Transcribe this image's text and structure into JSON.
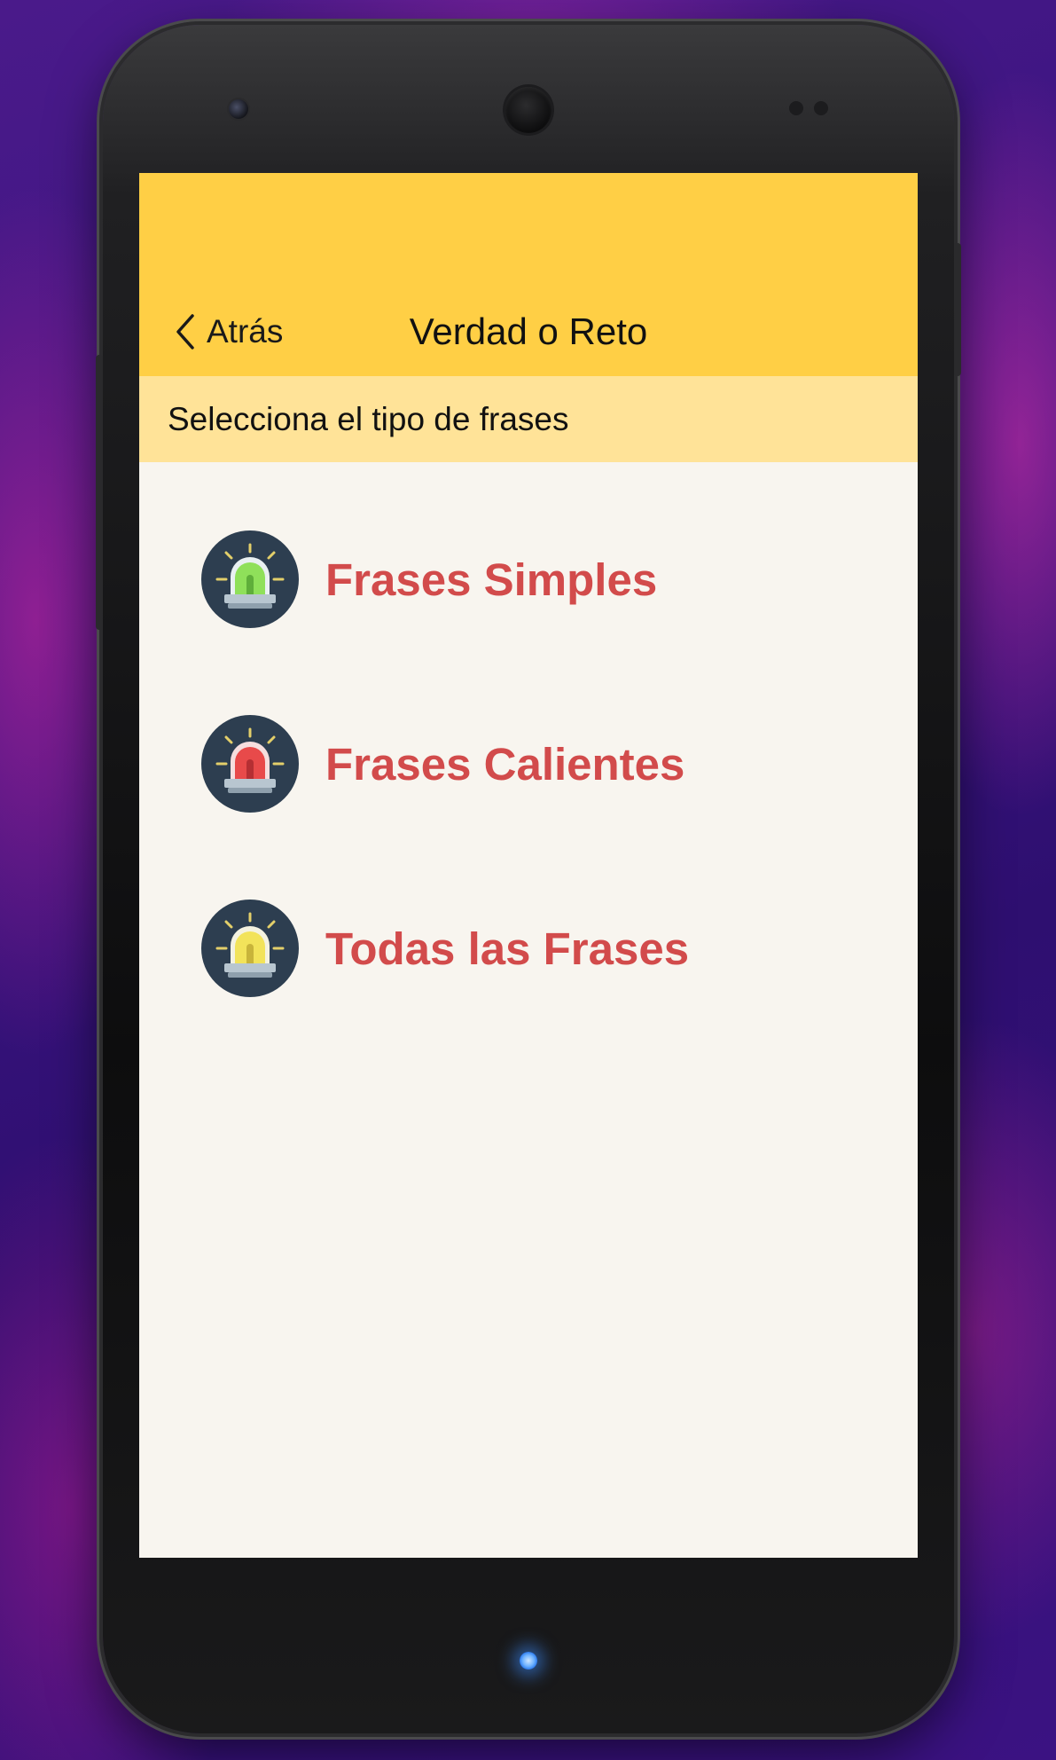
{
  "app": {
    "title": "Verdad o Reto",
    "back_label": "Atrás",
    "back_icon": "chevron-left-icon"
  },
  "subheader": {
    "text": "Selecciona el tipo de frases"
  },
  "options": [
    {
      "label": "Frases Simples",
      "icon": "siren-green-icon",
      "light_color": "#8fe05a"
    },
    {
      "label": "Frases Calientes",
      "icon": "siren-red-icon",
      "light_color": "#e84a4a"
    },
    {
      "label": "Todas las Frases",
      "icon": "siren-yellow-icon",
      "light_color": "#f2e35a"
    }
  ],
  "colors": {
    "app_bar": "#ffcf45",
    "sub_bar": "#ffe398",
    "screen_bg": "#f8f5ef",
    "option_text": "#d24b4b",
    "icon_circle": "#2d3e50"
  }
}
